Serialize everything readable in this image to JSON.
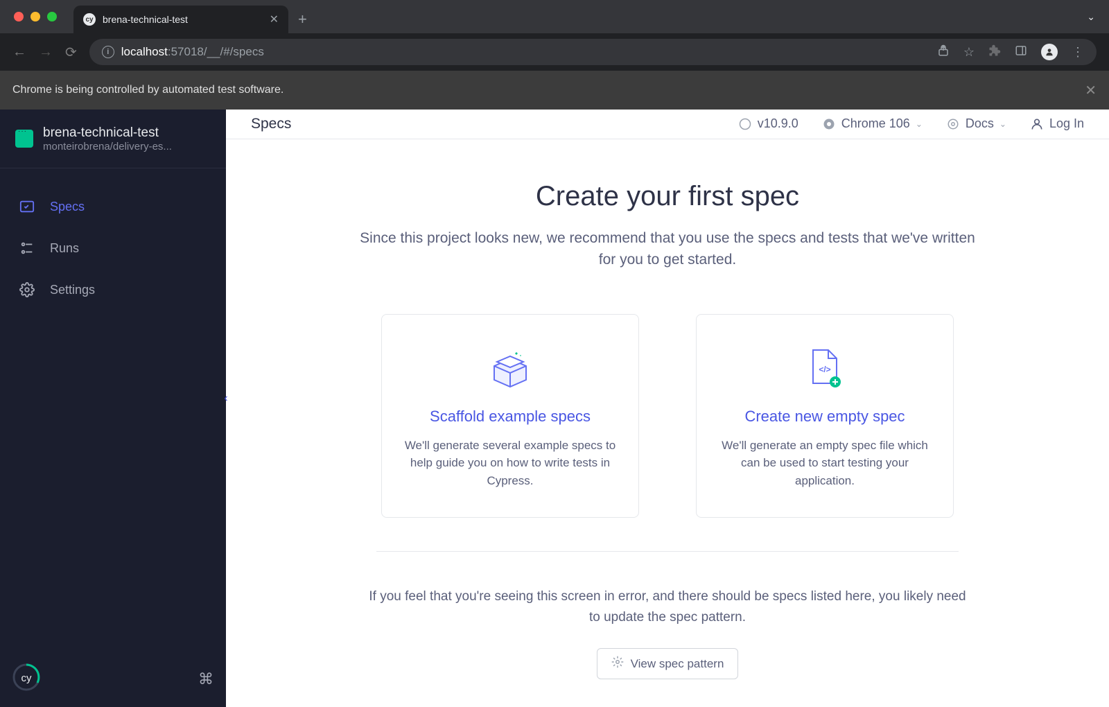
{
  "browser": {
    "tab_title": "brena-technical-test",
    "url_host": "localhost",
    "url_port": ":57018",
    "url_path": "/__/#/specs",
    "infobar_text": "Chrome is being controlled by automated test software."
  },
  "sidebar": {
    "project_name": "brena-technical-test",
    "project_path": "monteirobrena/delivery-es...",
    "items": [
      {
        "label": "Specs",
        "icon": "specs-icon",
        "active": true
      },
      {
        "label": "Runs",
        "icon": "runs-icon",
        "active": false
      },
      {
        "label": "Settings",
        "icon": "settings-icon",
        "active": false
      }
    ]
  },
  "topbar": {
    "title": "Specs",
    "version": "v10.9.0",
    "browser": "Chrome 106",
    "docs": "Docs",
    "login": "Log In"
  },
  "hero": {
    "title": "Create your first spec",
    "subtitle": "Since this project looks new, we recommend that you use the specs and tests that we've written for you to get started."
  },
  "cards": [
    {
      "title": "Scaffold example specs",
      "desc": "We'll generate several example specs to help guide you on how to write tests in Cypress."
    },
    {
      "title": "Create new empty spec",
      "desc": "We'll generate an empty spec file which can be used to start testing your application."
    }
  ],
  "error_hint": "If you feel that you're seeing this screen in error, and there should be specs listed here, you likely need to update the spec pattern.",
  "view_pattern_label": "View spec pattern"
}
